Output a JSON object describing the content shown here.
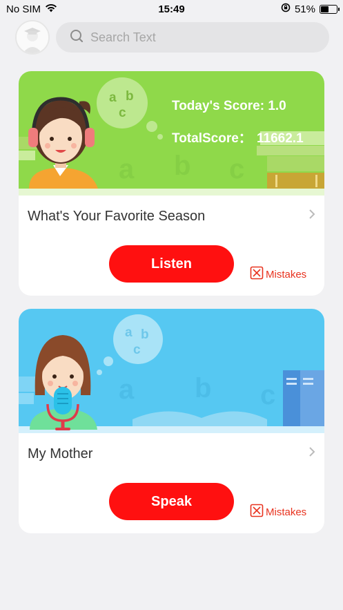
{
  "status_bar": {
    "carrier": "No SIM",
    "time": "15:49",
    "battery_percent": "51%",
    "battery_level": 0.51
  },
  "search": {
    "placeholder": "Search Text"
  },
  "cards": [
    {
      "today_score": "Today's Score: 1.0",
      "total_score_label": "TotalScore：",
      "total_score_value": "11662.1",
      "title": "What's Your Favorite Season",
      "button_label": "Listen",
      "mistakes_label": "Mistakes",
      "banner_color": "#8fd94a"
    },
    {
      "title": "My Mother",
      "button_label": "Speak",
      "mistakes_label": "Mistakes",
      "banner_color": "#56c8f2"
    }
  ],
  "colors": {
    "accent": "#ff1010",
    "mistakes": "#e8321e"
  }
}
